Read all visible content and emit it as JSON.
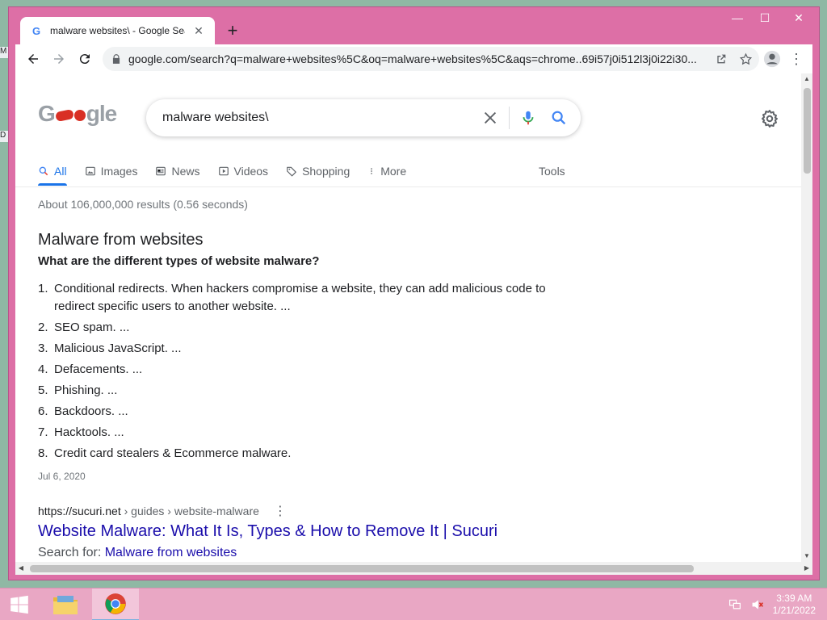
{
  "desktop": {
    "fragments": [
      "M",
      "D"
    ]
  },
  "window": {
    "controls": {
      "minimize": "—",
      "maximize": "☐",
      "close": "✕"
    }
  },
  "tab": {
    "favicon": "G",
    "title": "malware websites\\ - Google Search",
    "close": "✕"
  },
  "toolbar": {
    "url": "google.com/search?q=malware+websites%5C&oq=malware+websites%5C&aqs=chrome..69i57j0i512l3j0i22i30..."
  },
  "search": {
    "logo": "Google",
    "query": "malware websites\\",
    "tabs": [
      {
        "label": "All",
        "icon": "search-icon"
      },
      {
        "label": "Images",
        "icon": "image-icon"
      },
      {
        "label": "News",
        "icon": "news-icon"
      },
      {
        "label": "Videos",
        "icon": "video-icon"
      },
      {
        "label": "Shopping",
        "icon": "tag-icon"
      },
      {
        "label": "More",
        "icon": "more-vert-icon"
      }
    ],
    "tools": "Tools",
    "stats": "About 106,000,000 results (0.56 seconds)"
  },
  "snippet": {
    "title": "Malware from websites",
    "question": "What are the different types of website malware?",
    "items": [
      {
        "num": "1.",
        "text": "Conditional redirects. When hackers compromise a website, they can add malicious code to redirect specific users to another website. ..."
      },
      {
        "num": "2.",
        "text": "SEO spam. ..."
      },
      {
        "num": "3.",
        "text": "Malicious JavaScript. ..."
      },
      {
        "num": "4.",
        "text": "Defacements. ..."
      },
      {
        "num": "5.",
        "text": "Phishing. ..."
      },
      {
        "num": "6.",
        "text": "Backdoors. ..."
      },
      {
        "num": "7.",
        "text": "Hacktools. ..."
      },
      {
        "num": "8.",
        "text": "Credit card stealers & Ecommerce malware."
      }
    ],
    "date": "Jul 6, 2020"
  },
  "result": {
    "site": "https://sucuri.net",
    "path": " › guides › website-malware",
    "title": "Website Malware: What It Is, Types & How to Remove It | Sucuri",
    "search_for_label": "Search for: ",
    "search_for_link": "Malware from websites"
  },
  "taskbar": {
    "clock_time": "3:39 AM",
    "clock_date": "1/21/2022"
  },
  "colors": {
    "frame": "#dd6fa6",
    "taskbar": "#e9a7c4",
    "link": "#1a0dab",
    "accent": "#1a73e8"
  }
}
